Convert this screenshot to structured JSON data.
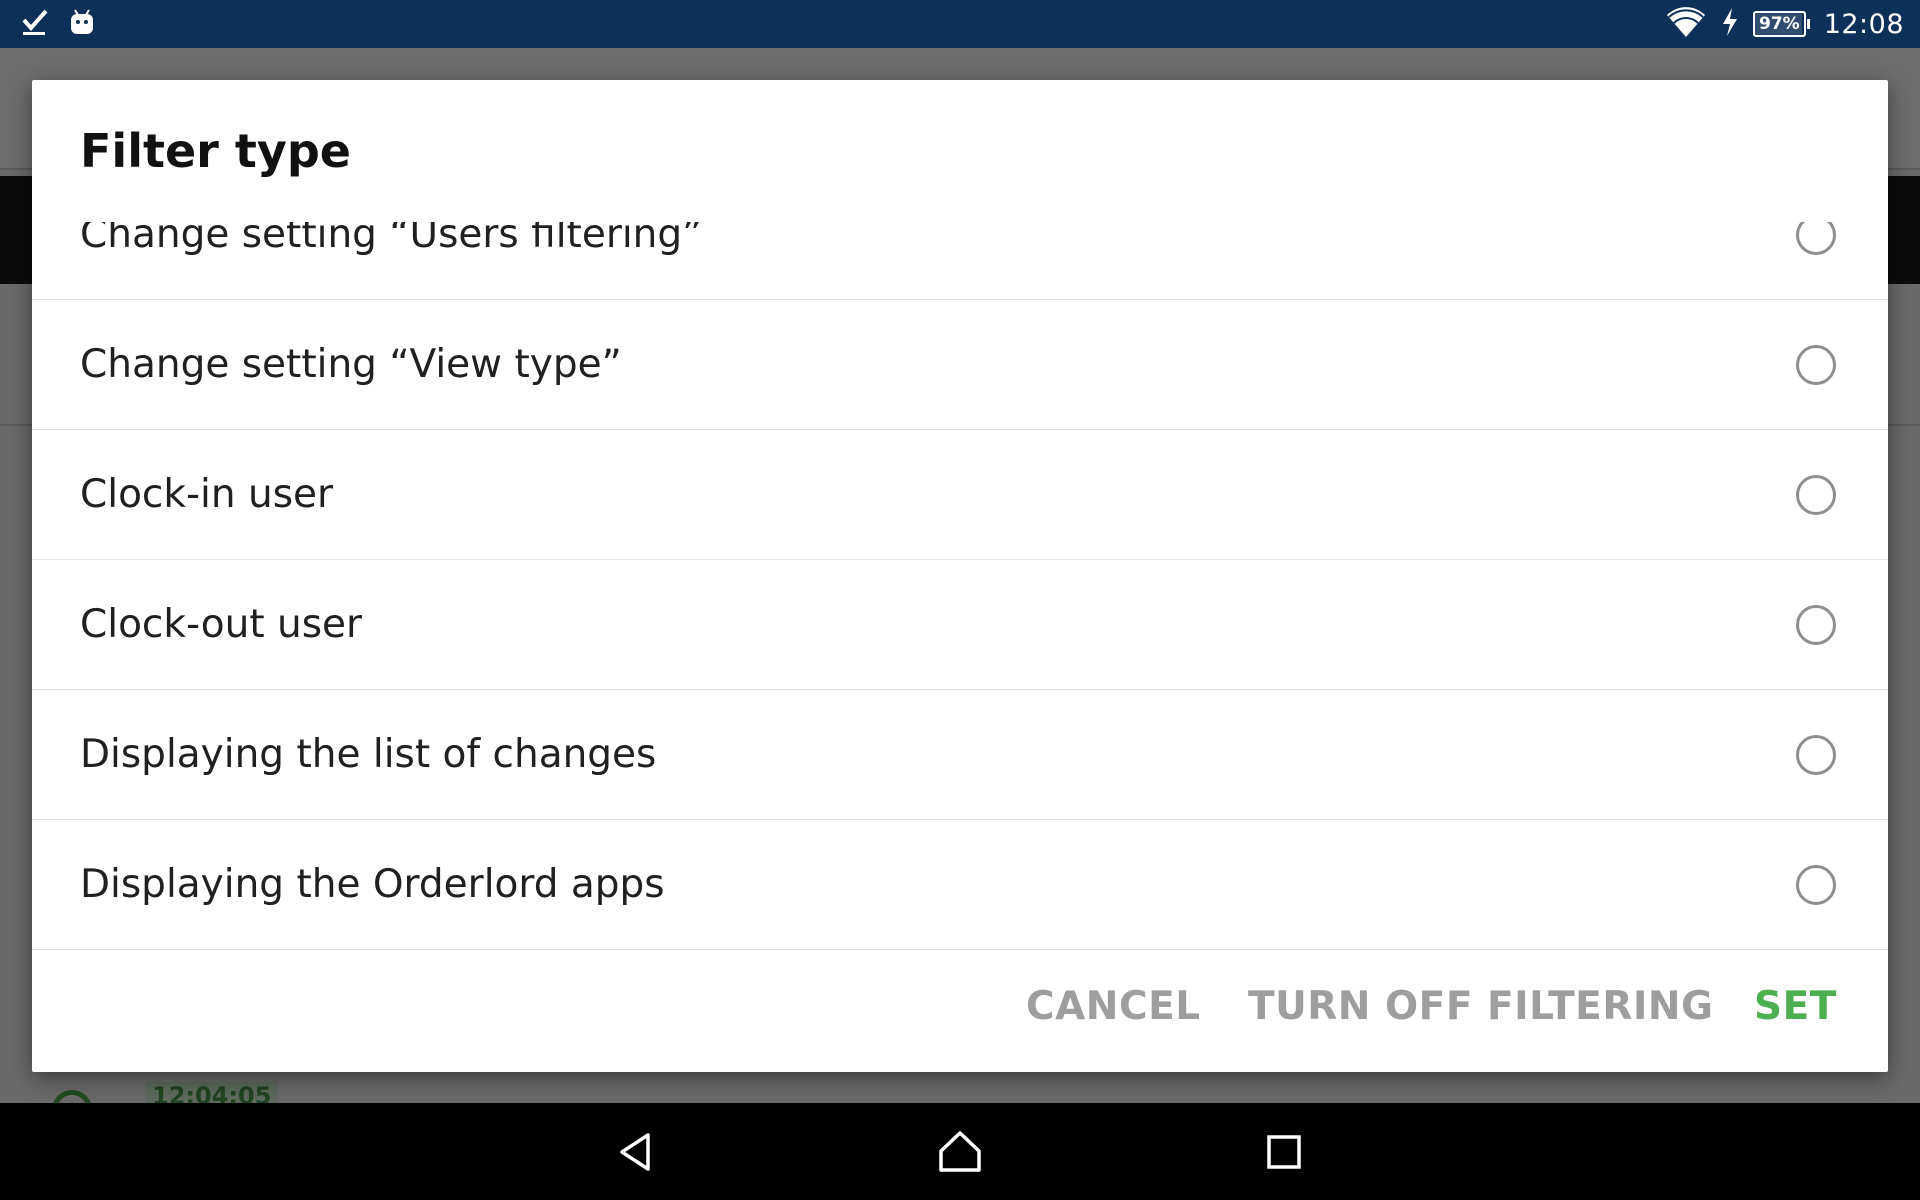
{
  "status_bar": {
    "left_icons": [
      "check-icon",
      "android-debug-icon"
    ],
    "right_icons": [
      "wifi-icon",
      "charging-icon",
      "battery-icon"
    ],
    "battery_percent": "97%",
    "battery_level": 0.97,
    "time": "12:08"
  },
  "background_app": {
    "title": "",
    "time_label": "12:04:05"
  },
  "dialog": {
    "title": "Filter type",
    "options": [
      {
        "label": "Change setting “Users filtering”",
        "selected": false
      },
      {
        "label": "Change setting “View type”",
        "selected": false
      },
      {
        "label": "Clock-in user",
        "selected": false
      },
      {
        "label": "Clock-out user",
        "selected": false
      },
      {
        "label": "Displaying the list of changes",
        "selected": false
      },
      {
        "label": "Displaying the Orderlord apps",
        "selected": false
      }
    ],
    "actions": {
      "cancel": "CANCEL",
      "turn_off": "TURN OFF FILTERING",
      "set": "SET"
    }
  },
  "nav_bar": {
    "buttons": [
      "back-icon",
      "home-icon",
      "recents-icon"
    ]
  },
  "colors": {
    "status_bar": "#0d3058",
    "accent_green": "#4caf50",
    "action_gray": "#9e9e9e",
    "scrim": "#6a6a6a"
  }
}
